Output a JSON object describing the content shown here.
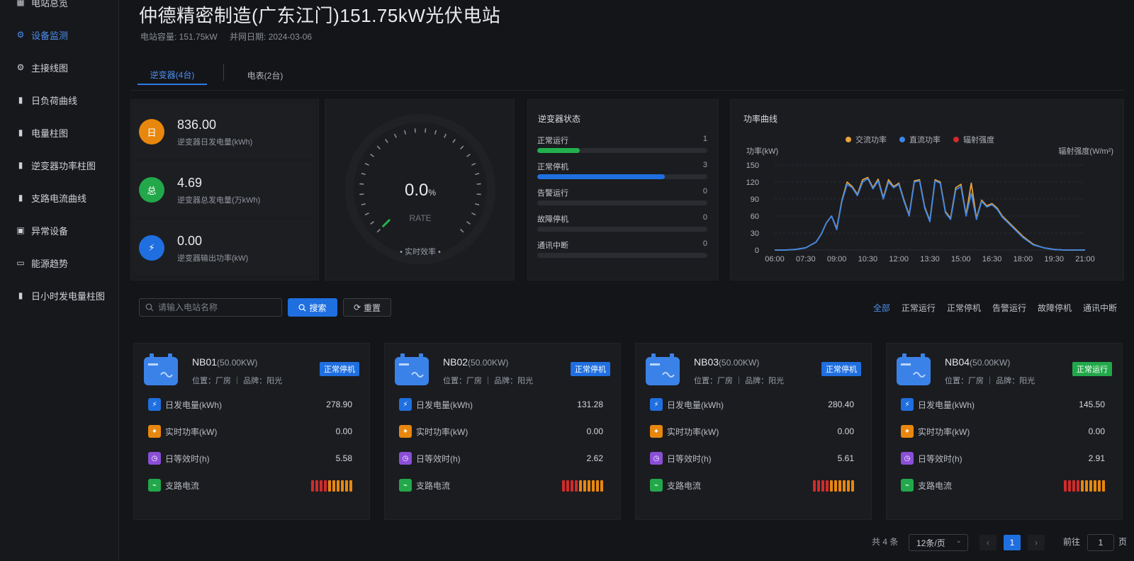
{
  "sidebar": {
    "items": [
      {
        "label": "电站总览",
        "icon": "grid-icon"
      },
      {
        "label": "设备监测",
        "icon": "gear-icon",
        "active": true
      },
      {
        "label": "主接线图",
        "icon": "gear-icon"
      },
      {
        "label": "日负荷曲线",
        "icon": "bar-chart-icon"
      },
      {
        "label": "电量柱图",
        "icon": "bar-chart-icon"
      },
      {
        "label": "逆变器功率柱图",
        "icon": "bar-chart-icon"
      },
      {
        "label": "支路电流曲线",
        "icon": "bar-chart-icon"
      },
      {
        "label": "异常设备",
        "icon": "alert-icon"
      },
      {
        "label": "能源趋势",
        "icon": "monitor-icon"
      },
      {
        "label": "日小时发电量柱图",
        "icon": "bar-chart-icon"
      }
    ]
  },
  "header": {
    "title": "仲德精密制造(广东江门)151.75kW光伏电站",
    "capacity": "电站容量: 151.75kW",
    "grid_date": "并网日期: 2024-03-06"
  },
  "tabs": [
    {
      "label": "逆变器(4台)",
      "active": true
    },
    {
      "label": "电表(2台)",
      "active": false
    }
  ],
  "stats": [
    {
      "value": "836.00",
      "label": "逆变器日发电量(kWh)",
      "icon_text": "日",
      "color": "#e8870e"
    },
    {
      "value": "4.69",
      "label": "逆变器总发电量(万kWh)",
      "icon_text": "总",
      "color": "#22a84a"
    },
    {
      "value": "0.00",
      "label": "逆变器输出功率(kW)",
      "icon_text": "⚡",
      "color": "#1f6fe0"
    }
  ],
  "gauge": {
    "value": "0.0",
    "unit": "%",
    "label": "RATE",
    "caption": "• 实时效率 •",
    "fraction": 0.0
  },
  "inverter_status": {
    "title": "逆变器状态",
    "rows": [
      {
        "label": "正常运行",
        "count": "1",
        "fraction": 0.25,
        "color": "#22b04e"
      },
      {
        "label": "正常停机",
        "count": "3",
        "fraction": 0.75,
        "color": "#1f6fe0"
      },
      {
        "label": "告警运行",
        "count": "0",
        "fraction": 0,
        "color": "#e8870e"
      },
      {
        "label": "故障停机",
        "count": "0",
        "fraction": 0,
        "color": "#d12b2b"
      },
      {
        "label": "通讯中断",
        "count": "0",
        "fraction": 0,
        "color": "#888888"
      }
    ]
  },
  "chart_data": {
    "type": "line",
    "title": "功率曲线",
    "ylabel": "功率(kW)",
    "y2label": "辐射强度(W/m²)",
    "ylim": [
      0,
      150
    ],
    "yticks": [
      0,
      30,
      60,
      90,
      120,
      150
    ],
    "x_ticks": [
      "06:00",
      "07:30",
      "09:00",
      "10:30",
      "12:00",
      "13:30",
      "15:00",
      "16:30",
      "18:00",
      "19:30",
      "21:00"
    ],
    "grid": true,
    "legend": "top",
    "x": [
      "06:00",
      "06:30",
      "07:00",
      "07:30",
      "08:00",
      "08:15",
      "08:30",
      "08:45",
      "09:00",
      "09:15",
      "09:30",
      "09:45",
      "10:00",
      "10:15",
      "10:30",
      "10:45",
      "11:00",
      "11:15",
      "11:30",
      "11:45",
      "12:00",
      "12:15",
      "12:30",
      "12:45",
      "13:00",
      "13:15",
      "13:30",
      "13:45",
      "14:00",
      "14:15",
      "14:30",
      "14:45",
      "15:00",
      "15:15",
      "15:30",
      "15:45",
      "16:00",
      "16:15",
      "16:30",
      "16:45",
      "17:00",
      "17:30",
      "18:00",
      "18:30",
      "19:00",
      "19:30",
      "20:00",
      "20:30",
      "21:00"
    ],
    "series": [
      {
        "name": "交流功率",
        "color": "#e8a33a",
        "values": [
          0,
          0,
          1,
          4,
          14,
          28,
          48,
          60,
          38,
          88,
          120,
          112,
          98,
          124,
          128,
          110,
          125,
          92,
          124,
          112,
          118,
          88,
          62,
          122,
          124,
          76,
          52,
          124,
          120,
          68,
          56,
          110,
          116,
          62,
          118,
          56,
          88,
          78,
          82,
          74,
          60,
          42,
          24,
          10,
          4,
          1,
          0,
          0,
          0
        ]
      },
      {
        "name": "直流功率",
        "color": "#3d86e8",
        "values": [
          0,
          0,
          1,
          4,
          14,
          28,
          48,
          60,
          36,
          86,
          116,
          110,
          96,
          120,
          126,
          108,
          122,
          90,
          120,
          110,
          116,
          86,
          60,
          120,
          122,
          74,
          50,
          122,
          118,
          66,
          54,
          106,
          112,
          60,
          100,
          54,
          86,
          76,
          80,
          72,
          58,
          40,
          22,
          9,
          4,
          1,
          0,
          0,
          0
        ]
      },
      {
        "name": "辐射强度",
        "color": "#d12b2b",
        "values": []
      }
    ]
  },
  "filter": {
    "search_placeholder": "请输入电站名称",
    "search_label": "搜索",
    "reset_label": "重置",
    "options": [
      "全部",
      "正常运行",
      "正常停机",
      "告警运行",
      "故障停机",
      "通讯中断"
    ]
  },
  "cards": [
    {
      "name": "NB01",
      "rated": "(50.00KW)",
      "location": "位置：厂房 ｜ 品牌：阳光",
      "status": "正常停机",
      "status_color": "#1f6fe0",
      "daily": "278.90",
      "power": "0.00",
      "hours": "5.58",
      "strings": [
        "#d12b2b",
        "#d12b2b",
        "#d12b2b",
        "#d12b2b",
        "#e8870e",
        "#e8870e",
        "#e8870e",
        "#e8870e",
        "#e8870e",
        "#e8870e"
      ]
    },
    {
      "name": "NB02",
      "rated": "(50.00KW)",
      "location": "位置：厂房 ｜ 品牌：阳光",
      "status": "正常停机",
      "status_color": "#1f6fe0",
      "daily": "131.28",
      "power": "0.00",
      "hours": "2.62",
      "strings": [
        "#d12b2b",
        "#d12b2b",
        "#d12b2b",
        "#d12b2b",
        "#e8870e",
        "#e8870e",
        "#e8870e",
        "#e8870e",
        "#e8870e",
        "#e8870e"
      ]
    },
    {
      "name": "NB03",
      "rated": "(50.00KW)",
      "location": "位置：厂房 ｜ 品牌：阳光",
      "status": "正常停机",
      "status_color": "#1f6fe0",
      "daily": "280.40",
      "power": "0.00",
      "hours": "5.61",
      "strings": [
        "#d12b2b",
        "#d12b2b",
        "#d12b2b",
        "#d12b2b",
        "#e8870e",
        "#e8870e",
        "#e8870e",
        "#e8870e",
        "#e8870e",
        "#e8870e"
      ]
    },
    {
      "name": "NB04",
      "rated": "(50.00KW)",
      "location": "位置：厂房 ｜ 品牌：阳光",
      "status": "正常运行",
      "status_color": "#22a84a",
      "daily": "145.50",
      "power": "0.00",
      "hours": "2.91",
      "strings": [
        "#d12b2b",
        "#d12b2b",
        "#d12b2b",
        "#d12b2b",
        "#e8870e",
        "#e8870e",
        "#e8870e",
        "#e8870e",
        "#e8870e",
        "#e8870e"
      ]
    }
  ],
  "card_labels": {
    "daily": "日发电量(kWh)",
    "power": "实时功率(kW)",
    "hours": "日等效时(h)",
    "strings": "支路电流"
  },
  "pagination": {
    "total": "共 4 条",
    "page_size": "12条/页",
    "current": "1",
    "jump_label": "前往",
    "jump_value": "1",
    "page_suffix": "页",
    "prev": "‹",
    "next": "›"
  }
}
